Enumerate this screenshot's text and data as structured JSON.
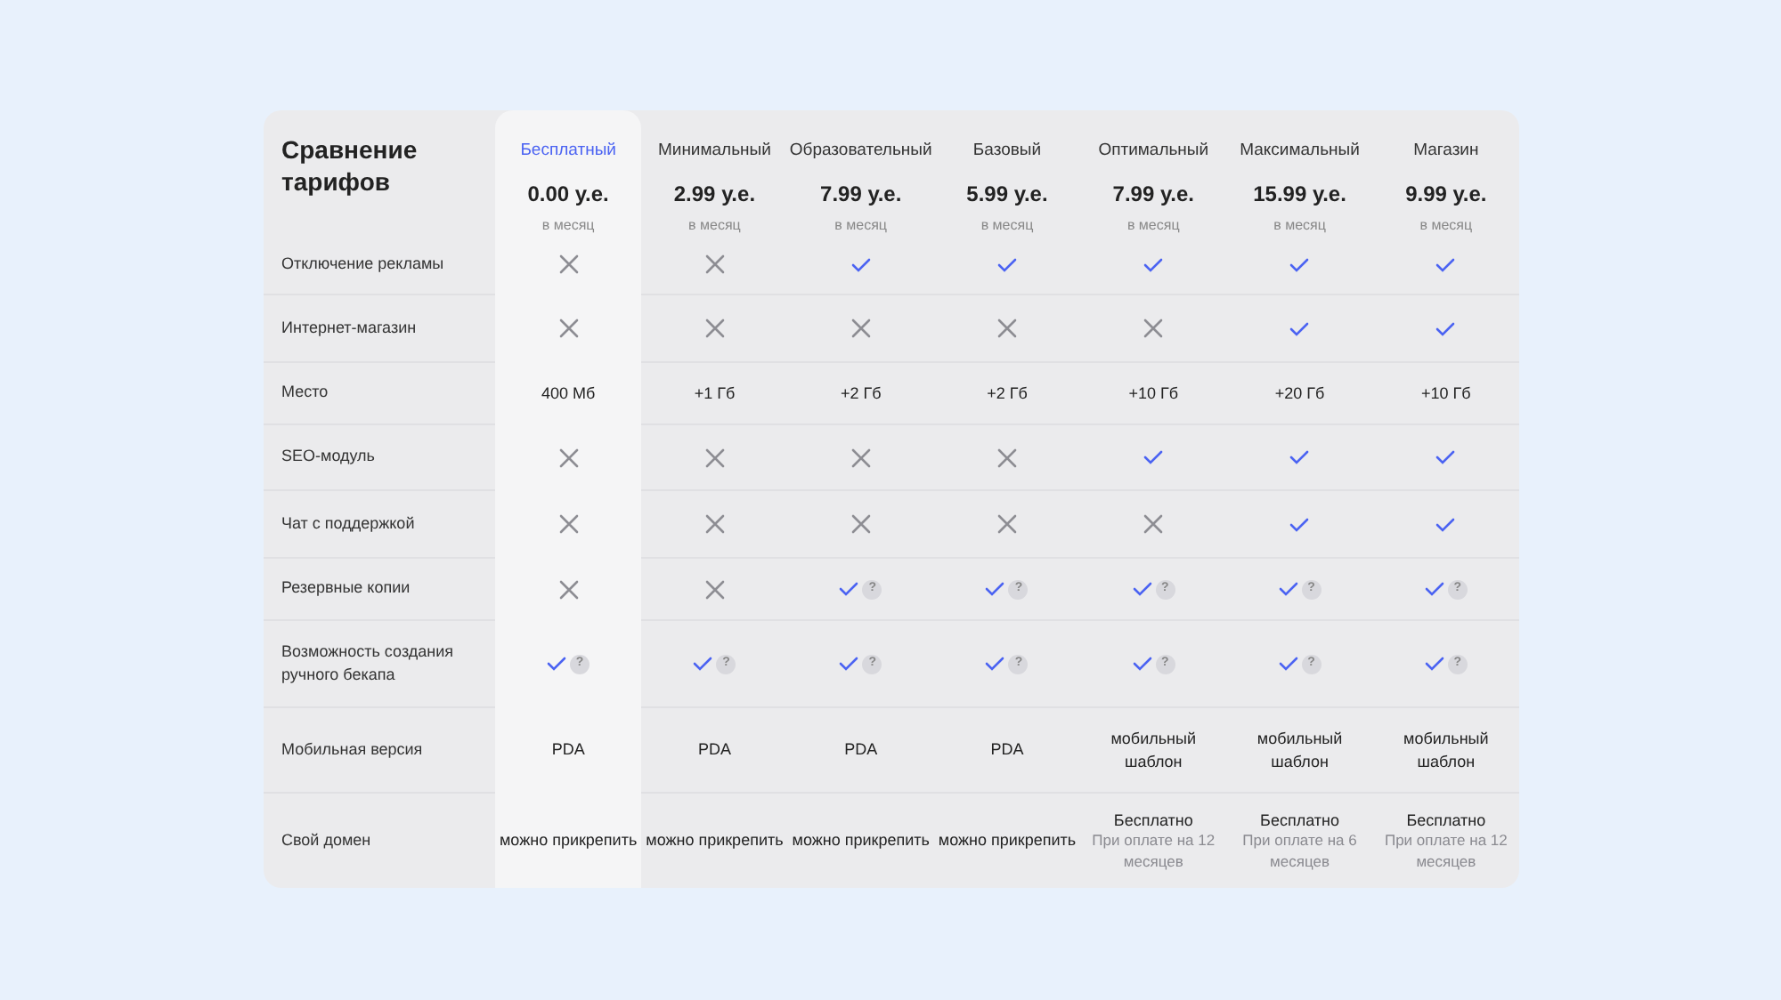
{
  "title": "Сравнение тарифов",
  "plans": [
    {
      "name": "Бесплатный",
      "price": "0.00 у.е.",
      "period": "в месяц",
      "selected": true
    },
    {
      "name": "Минимальный",
      "price": "2.99 у.е.",
      "period": "в месяц",
      "selected": false
    },
    {
      "name": "Образовательный",
      "price": "7.99 у.е.",
      "period": "в месяц",
      "selected": false
    },
    {
      "name": "Базовый",
      "price": "5.99 у.е.",
      "period": "в месяц",
      "selected": false
    },
    {
      "name": "Оптимальный",
      "price": "7.99 у.е.",
      "period": "в месяц",
      "selected": false
    },
    {
      "name": "Максимальный",
      "price": "15.99 у.е.",
      "period": "в месяц",
      "selected": false
    },
    {
      "name": "Магазин",
      "price": "9.99 у.е.",
      "period": "в месяц",
      "selected": false
    }
  ],
  "rows": [
    {
      "label": "Отключение рекламы",
      "cells": [
        {
          "kind": "no"
        },
        {
          "kind": "no"
        },
        {
          "kind": "yes"
        },
        {
          "kind": "yes"
        },
        {
          "kind": "yes"
        },
        {
          "kind": "yes"
        },
        {
          "kind": "yes"
        }
      ]
    },
    {
      "label": "Интернет-магазин",
      "cells": [
        {
          "kind": "no"
        },
        {
          "kind": "no"
        },
        {
          "kind": "no"
        },
        {
          "kind": "no"
        },
        {
          "kind": "no"
        },
        {
          "kind": "yes"
        },
        {
          "kind": "yes"
        }
      ]
    },
    {
      "label": "Место",
      "cells": [
        {
          "kind": "text",
          "text": "400 Мб"
        },
        {
          "kind": "text",
          "text": "+1 Гб"
        },
        {
          "kind": "text",
          "text": "+2 Гб"
        },
        {
          "kind": "text",
          "text": "+2 Гб"
        },
        {
          "kind": "text",
          "text": "+10 Гб"
        },
        {
          "kind": "text",
          "text": "+20 Гб"
        },
        {
          "kind": "text",
          "text": "+10 Гб"
        }
      ]
    },
    {
      "label": "SEO-модуль",
      "cells": [
        {
          "kind": "no"
        },
        {
          "kind": "no"
        },
        {
          "kind": "no"
        },
        {
          "kind": "no"
        },
        {
          "kind": "yes"
        },
        {
          "kind": "yes"
        },
        {
          "kind": "yes"
        }
      ]
    },
    {
      "label": "Чат с поддержкой",
      "cells": [
        {
          "kind": "no"
        },
        {
          "kind": "no"
        },
        {
          "kind": "no"
        },
        {
          "kind": "no"
        },
        {
          "kind": "no"
        },
        {
          "kind": "yes"
        },
        {
          "kind": "yes"
        }
      ]
    },
    {
      "label": "Резервные копии",
      "cells": [
        {
          "kind": "no"
        },
        {
          "kind": "no"
        },
        {
          "kind": "yes",
          "help": "?"
        },
        {
          "kind": "yes",
          "help": "?"
        },
        {
          "kind": "yes",
          "help": "?"
        },
        {
          "kind": "yes",
          "help": "?"
        },
        {
          "kind": "yes",
          "help": "?"
        }
      ]
    },
    {
      "label": "Возможность создания ручного бекапа",
      "cells": [
        {
          "kind": "yes",
          "help": "?"
        },
        {
          "kind": "yes",
          "help": "?"
        },
        {
          "kind": "yes",
          "help": "?"
        },
        {
          "kind": "yes",
          "help": "?"
        },
        {
          "kind": "yes",
          "help": "?"
        },
        {
          "kind": "yes",
          "help": "?"
        },
        {
          "kind": "yes",
          "help": "?"
        }
      ]
    },
    {
      "label": "Мобильная версия",
      "cells": [
        {
          "kind": "text",
          "text": "PDA"
        },
        {
          "kind": "text",
          "text": "PDA"
        },
        {
          "kind": "text",
          "text": "PDA"
        },
        {
          "kind": "text",
          "text": "PDA"
        },
        {
          "kind": "text",
          "text": "мобильный шаблон"
        },
        {
          "kind": "text",
          "text": "мобильный шаблон"
        },
        {
          "kind": "text",
          "text": "мобильный шаблон"
        }
      ]
    },
    {
      "label": "Свой домен",
      "cells": [
        {
          "kind": "text",
          "text": "можно прикрепить"
        },
        {
          "kind": "text",
          "text": "можно прикрепить"
        },
        {
          "kind": "text",
          "text": "можно прикрепить"
        },
        {
          "kind": "text",
          "text": "можно прикрепить"
        },
        {
          "kind": "text",
          "text": "Бесплатно",
          "note": "При оплате на 12 месяцев"
        },
        {
          "kind": "text",
          "text": "Бесплатно",
          "note": "При оплате на 6 месяцев"
        },
        {
          "kind": "text",
          "text": "Бесплатно",
          "note": "При оплате на 12 месяцев"
        }
      ]
    }
  ]
}
